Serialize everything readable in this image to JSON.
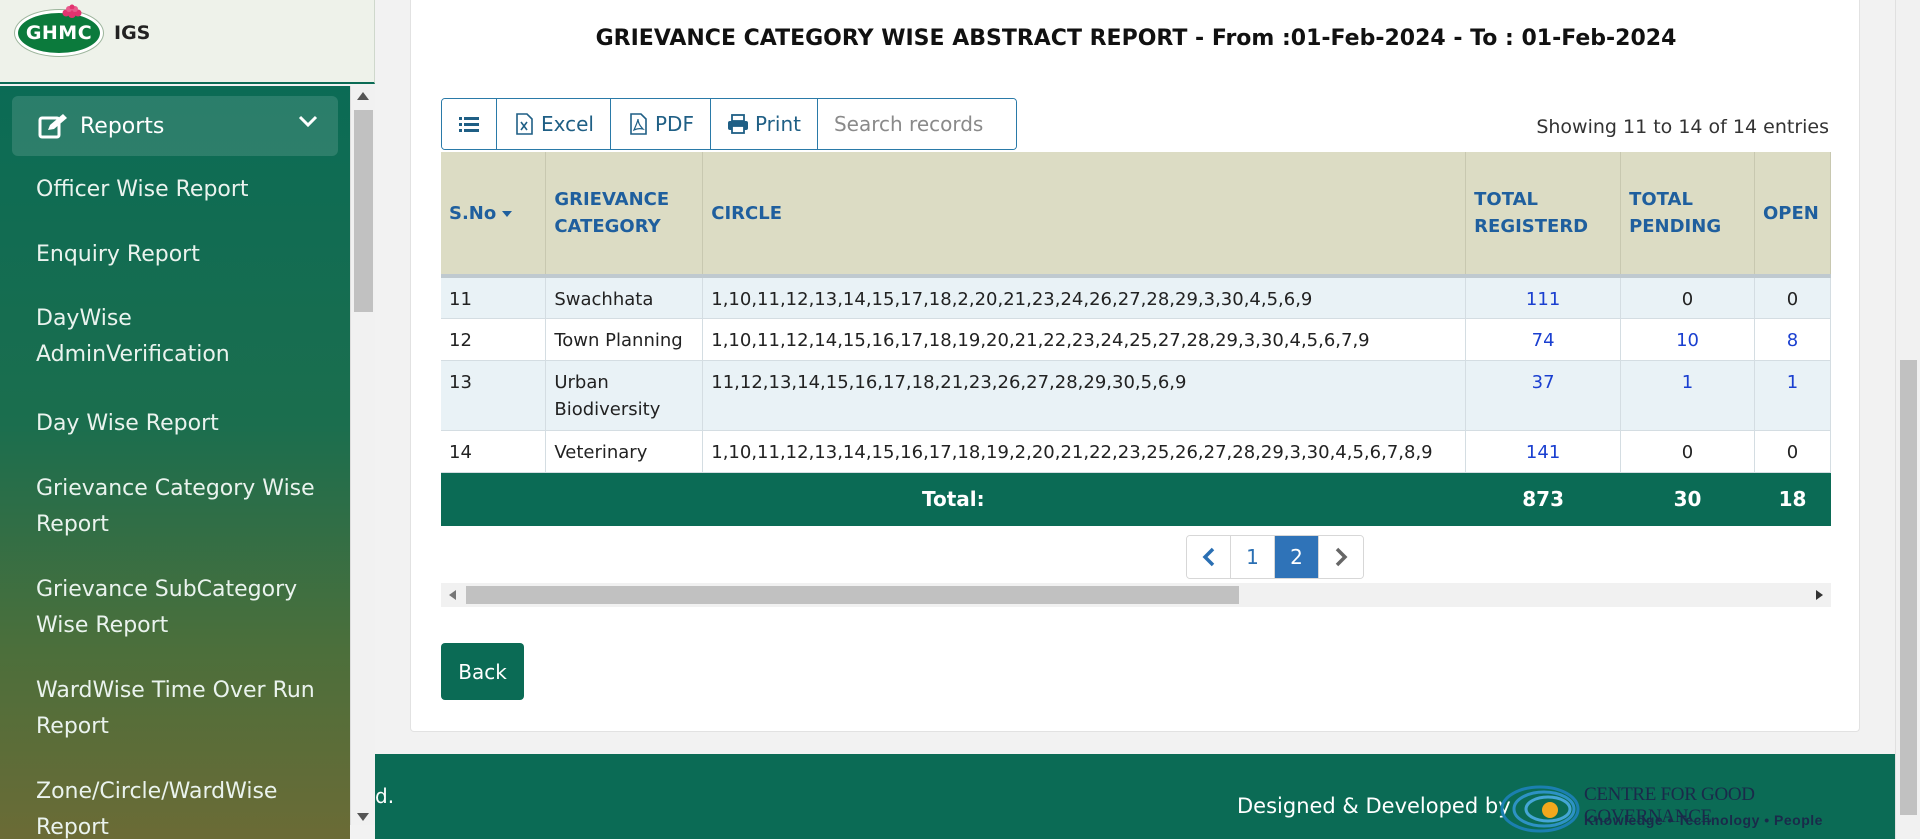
{
  "brand": {
    "logo_text": "GHMC",
    "app_name": "IGS"
  },
  "sidebar": {
    "section_label": "Reports",
    "items": [
      {
        "label": "Officer Wise Report"
      },
      {
        "label": "Enquiry Report"
      },
      {
        "label": "DayWise AdminVerification"
      },
      {
        "label": "Day Wise Report"
      },
      {
        "label": "Grievance Category Wise Report"
      },
      {
        "label": "Grievance SubCategory Wise Report"
      },
      {
        "label": "WardWise Time Over Run Report"
      },
      {
        "label": "Zone/Circle/WardWise Report"
      }
    ]
  },
  "report": {
    "title": "GRIEVANCE CATEGORY WISE ABSTRACT REPORT - From :01-Feb-2024 - To : 01-Feb-2024",
    "toolbar": {
      "excel_label": "Excel",
      "pdf_label": "PDF",
      "print_label": "Print",
      "search_placeholder": "Search records"
    },
    "showing_text": "Showing 11 to 14 of 14 entries",
    "columns": {
      "sno": "S.No",
      "category": "GRIEVANCE CATEGORY",
      "circle": "CIRCLE",
      "total_registered": "TOTAL REGISTERD",
      "total_pending": "TOTAL PENDING",
      "open": "OPEN"
    },
    "rows": [
      {
        "sno": "11",
        "category": "Swachhata",
        "circle": "1,10,11,12,13,14,15,17,18,2,20,21,23,24,26,27,28,29,3,30,4,5,6,9",
        "total_registered": "111",
        "total_pending": "0",
        "open": "0"
      },
      {
        "sno": "12",
        "category": "Town Planning",
        "circle": "1,10,11,12,14,15,16,17,18,19,20,21,22,23,24,25,27,28,29,3,30,4,5,6,7,9",
        "total_registered": "74",
        "total_pending": "10",
        "open": "8"
      },
      {
        "sno": "13",
        "category": "Urban Biodiversity",
        "circle": "11,12,13,14,15,16,17,18,21,23,26,27,28,29,30,5,6,9",
        "total_registered": "37",
        "total_pending": "1",
        "open": "1"
      },
      {
        "sno": "14",
        "category": "Veterinary",
        "circle": "1,10,11,12,13,14,15,16,17,18,19,2,20,21,22,23,25,26,27,28,29,3,30,4,5,6,7,8,9",
        "total_registered": "141",
        "total_pending": "0",
        "open": "0"
      }
    ],
    "totals": {
      "label": "Total:",
      "total_registered": "873",
      "total_pending": "30",
      "open": "18"
    },
    "pagination": {
      "pages": [
        "1",
        "2"
      ],
      "current": "2"
    },
    "back_label": "Back"
  },
  "footer": {
    "copyright_fragment": "d.",
    "designed_by": "Designed & Developed by",
    "org_name": "CENTRE FOR GOOD GOVERNANCE",
    "org_tagline": "Knowledge • Technology • People"
  },
  "colors": {
    "primary": "#0b6b55",
    "header_bg": "#dcdcc4",
    "link": "#1a3fd0",
    "page_active": "#2f73b8"
  }
}
